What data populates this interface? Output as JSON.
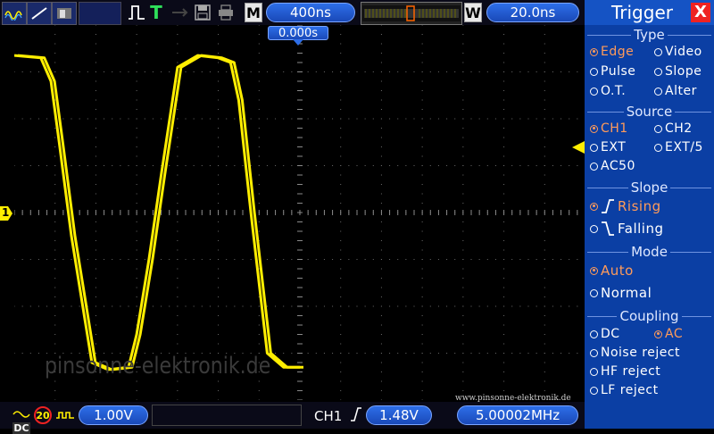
{
  "top": {
    "timebase": "400ns",
    "mode_label": "M",
    "window_label": "W",
    "trigger_pos": "20.0ns",
    "trigger_time_marker": "0.000s",
    "run_status": "T"
  },
  "side": {
    "title": "Trigger",
    "close": "X",
    "sections": {
      "type": {
        "header": "Type",
        "options": [
          "Edge",
          "Video",
          "Pulse",
          "Slope",
          "O.T.",
          "Alter"
        ],
        "selected": "Edge"
      },
      "source": {
        "header": "Source",
        "options": [
          "CH1",
          "CH2",
          "EXT",
          "EXT/5",
          "AC50"
        ],
        "selected": "CH1"
      },
      "slope": {
        "header": "Slope",
        "options": [
          "Rising",
          "Falling"
        ],
        "selected": "Rising"
      },
      "mode": {
        "header": "Mode",
        "options": [
          "Auto",
          "Normal"
        ],
        "selected": "Auto"
      },
      "coupling": {
        "header": "Coupling",
        "options": [
          "DC",
          "AC",
          "Noise reject",
          "HF reject",
          "LF reject"
        ],
        "selected": "AC"
      }
    }
  },
  "bottom": {
    "coupling": "DC",
    "bw_limit": "20",
    "ch1_scale": "1.00V",
    "trig_channel": "CH1",
    "trig_level": "1.48V",
    "frequency": "5.00002MHz"
  },
  "channel_marker": "1",
  "watermark": "pinsonne-elektronik.de",
  "url": "www.pinsonne-elektronik.de",
  "colors": {
    "trace": "#ffee00",
    "accent": "#1553c4",
    "selected": "#ff9b5a"
  },
  "chart_data": {
    "type": "line",
    "title": "",
    "xlabel": "",
    "ylabel": "",
    "grid": true,
    "grid_divisions": {
      "x": 14,
      "y": 8
    },
    "series": [
      {
        "x": [
          0,
          0.65,
          0.9,
          1.1,
          1.4,
          1.9,
          2.3,
          2.8,
          3.0,
          3.3,
          3.6,
          4.0,
          4.5,
          5.0,
          5.3,
          5.5,
          5.8,
          6.2,
          6.6,
          7.0
        ],
        "values": [
          3.35,
          3.3,
          2.8,
          1.5,
          -0.5,
          -3.2,
          -3.35,
          -3.3,
          -2.6,
          -1.0,
          0.8,
          3.1,
          3.35,
          3.3,
          3.2,
          2.4,
          0.0,
          -3.0,
          -3.3,
          -3.3
        ]
      }
    ]
  }
}
